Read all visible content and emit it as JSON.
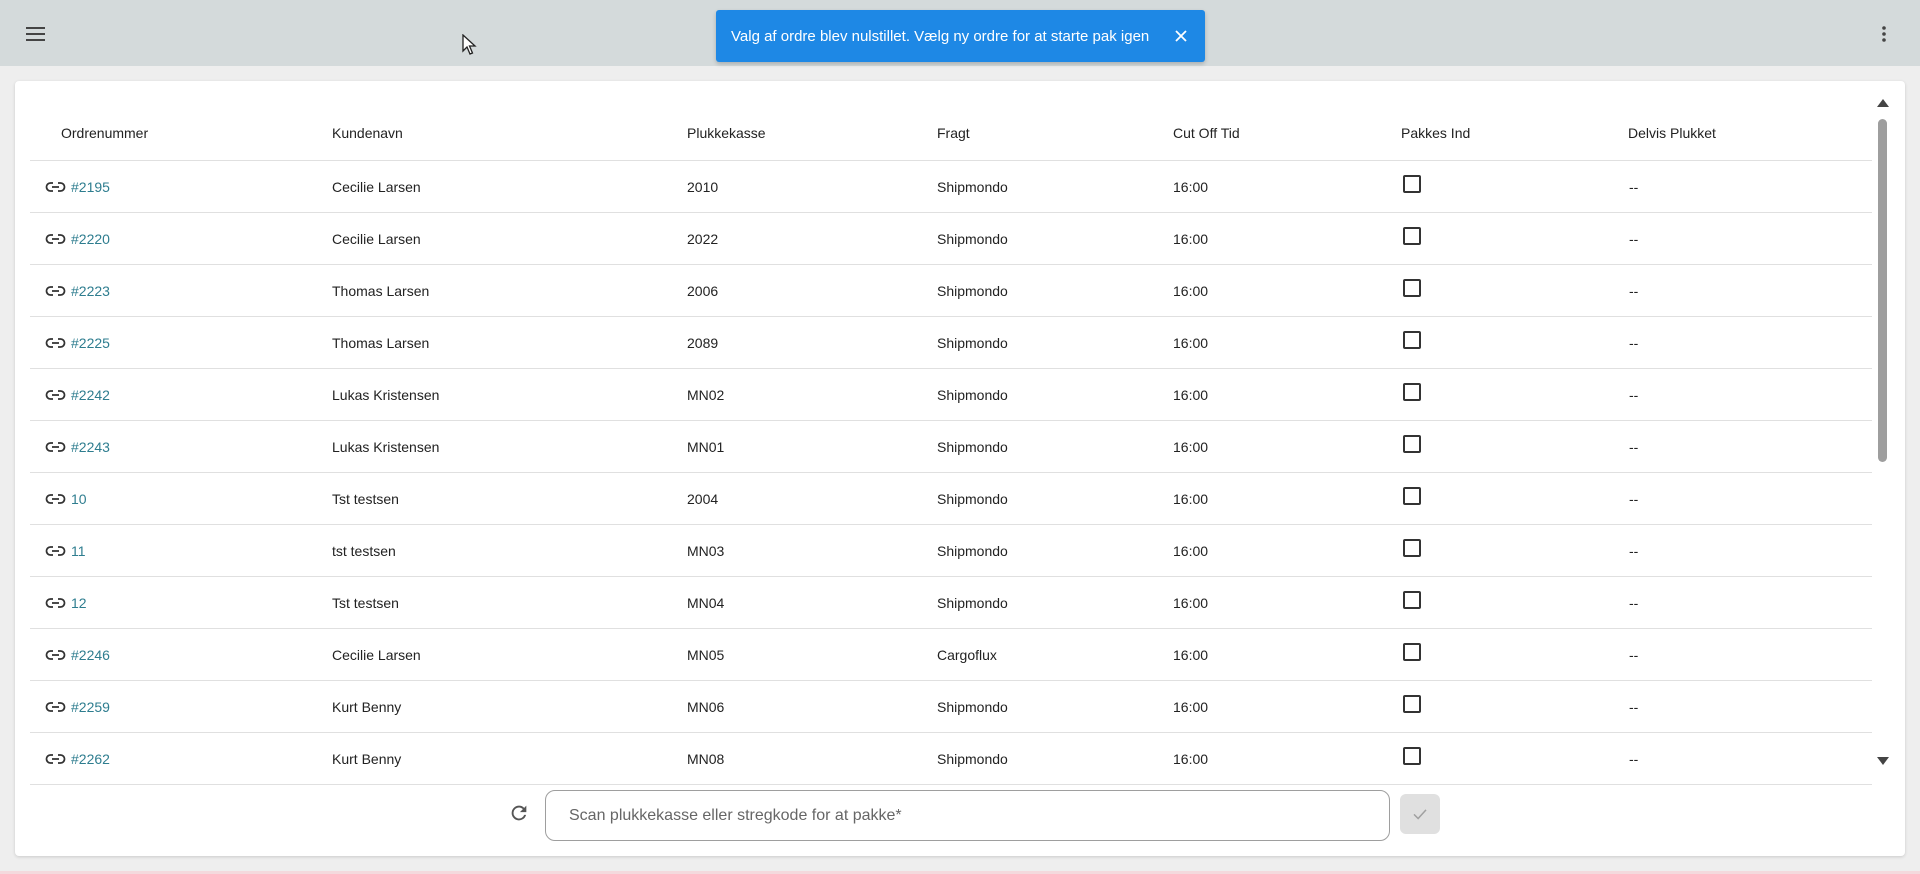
{
  "toast": {
    "message": "Valg af ordre blev nulstillet. Vælg ny ordre for at starte pak igen"
  },
  "table": {
    "headers": [
      "Ordrenummer",
      "Kundenavn",
      "Plukkekasse",
      "Fragt",
      "Cut Off Tid",
      "Pakkes Ind",
      "Delvis Plukket"
    ],
    "rows": [
      {
        "order": "#2195",
        "customer": "Cecilie Larsen",
        "box": "2010",
        "shipping": "Shipmondo",
        "cutoff": "16:00",
        "partial": "--"
      },
      {
        "order": "#2220",
        "customer": "Cecilie Larsen",
        "box": "2022",
        "shipping": "Shipmondo",
        "cutoff": "16:00",
        "partial": "--"
      },
      {
        "order": "#2223",
        "customer": "Thomas Larsen",
        "box": "2006",
        "shipping": "Shipmondo",
        "cutoff": "16:00",
        "partial": "--"
      },
      {
        "order": "#2225",
        "customer": "Thomas Larsen",
        "box": "2089",
        "shipping": "Shipmondo",
        "cutoff": "16:00",
        "partial": "--"
      },
      {
        "order": "#2242",
        "customer": "Lukas Kristensen",
        "box": "MN02",
        "shipping": "Shipmondo",
        "cutoff": "16:00",
        "partial": "--"
      },
      {
        "order": "#2243",
        "customer": "Lukas Kristensen",
        "box": "MN01",
        "shipping": "Shipmondo",
        "cutoff": "16:00",
        "partial": "--"
      },
      {
        "order": "10",
        "customer": "Tst testsen",
        "box": "2004",
        "shipping": "Shipmondo",
        "cutoff": "16:00",
        "partial": "--"
      },
      {
        "order": "11",
        "customer": "tst testsen",
        "box": "MN03",
        "shipping": "Shipmondo",
        "cutoff": "16:00",
        "partial": "--"
      },
      {
        "order": "12",
        "customer": "Tst testsen",
        "box": "MN04",
        "shipping": "Shipmondo",
        "cutoff": "16:00",
        "partial": "--"
      },
      {
        "order": "#2246",
        "customer": "Cecilie Larsen",
        "box": "MN05",
        "shipping": "Cargoflux",
        "cutoff": "16:00",
        "partial": "--"
      },
      {
        "order": "#2259",
        "customer": "Kurt Benny",
        "box": "MN06",
        "shipping": "Shipmondo",
        "cutoff": "16:00",
        "partial": "--"
      },
      {
        "order": "#2262",
        "customer": "Kurt Benny",
        "box": "MN08",
        "shipping": "Shipmondo",
        "cutoff": "16:00",
        "partial": "--"
      }
    ]
  },
  "scan": {
    "placeholder": "Scan plukkekasse eller stregkode for at pakke*"
  },
  "colors": {
    "topbar": "#d4dadb",
    "toast": "#1e88e5",
    "link": "#2e7d8f"
  },
  "icons": {
    "menu": "menu-icon",
    "more": "more-vert-icon",
    "close": "close-icon",
    "link": "link-icon",
    "refresh": "refresh-icon",
    "confirm": "check-icon"
  }
}
